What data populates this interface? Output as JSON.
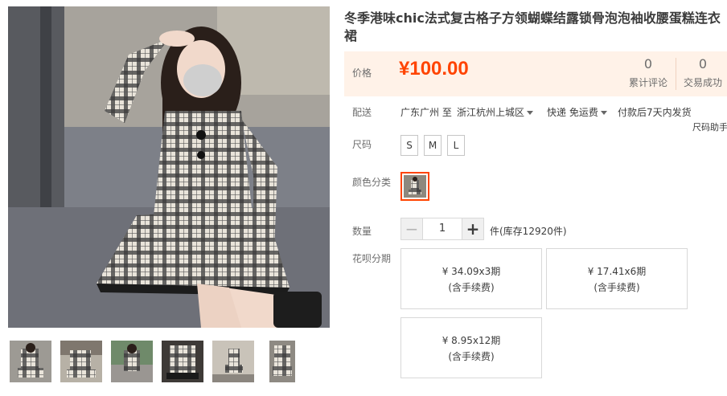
{
  "title": "冬季港味chic法式复古格子方领蝴蝶结露锁骨泡泡袖收腰蛋糕连衣裙",
  "price": {
    "label": "价格",
    "value": "¥100.00"
  },
  "stats": [
    {
      "num": "0",
      "caption": "累计评论"
    },
    {
      "num": "0",
      "caption": "交易成功"
    }
  ],
  "delivery": {
    "label": "配送",
    "from": "广东广州 至",
    "to": "浙江杭州上城区",
    "method": "快递 免运费",
    "ship_time": "付款后7天内发货",
    "size_helper": "尺码助手"
  },
  "size": {
    "label": "尺码",
    "options": [
      "S",
      "M",
      "L"
    ]
  },
  "color": {
    "label": "颜色分类"
  },
  "quantity": {
    "label": "数量",
    "minus": "−",
    "plus": "+",
    "value": "1",
    "stock": "件(库存12920件)"
  },
  "installments": {
    "label": "花呗分期",
    "options": [
      {
        "line1": "¥ 34.09x3期",
        "line2": "(含手续费)"
      },
      {
        "line1": "¥ 17.41x6期",
        "line2": "(含手续费)"
      },
      {
        "line1": "¥ 8.95x12期",
        "line2": "(含手续费)"
      }
    ]
  },
  "colors": {
    "accent": "#ff4400",
    "price_bg": "#fff2e8"
  }
}
